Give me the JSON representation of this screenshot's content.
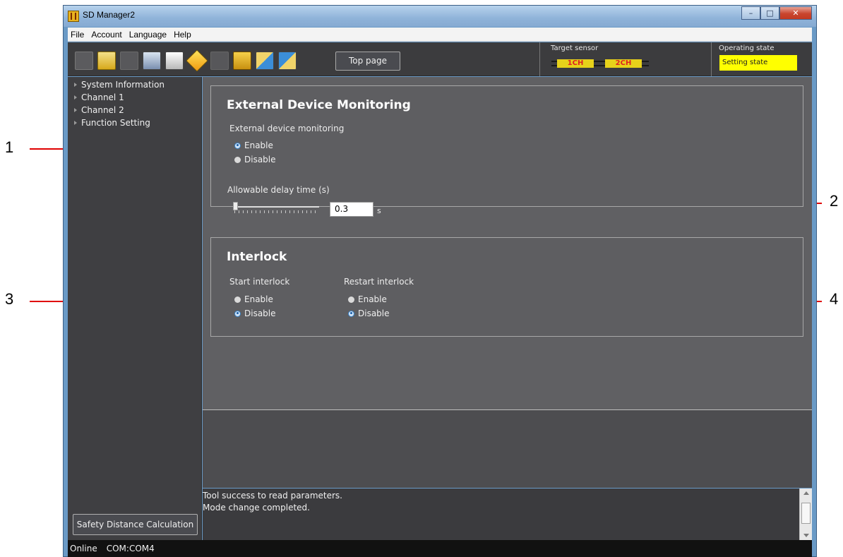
{
  "window": {
    "title": "SD Manager2"
  },
  "menu": [
    "File",
    "Account",
    "Language",
    "Help"
  ],
  "toolbar": {
    "top_page_label": "Top page",
    "icons": [
      "device-icon",
      "folder-open-icon",
      "disabled-device-icon",
      "save-icon",
      "print-icon",
      "transfer-icon",
      "key-icon",
      "lock-icon",
      "import-icon",
      "export-icon"
    ]
  },
  "target_sensor": {
    "label": "Target sensor",
    "ch1": "1CH",
    "ch2": "2CH"
  },
  "operating_state": {
    "label": "Operating state",
    "value": "Setting state"
  },
  "tree": [
    "System Information",
    "Channel 1",
    "Channel 2",
    "Function Setting"
  ],
  "left_button": "Safety Distance Calculation",
  "edm": {
    "title": "External Device Monitoring",
    "monitoring_label": "External device monitoring",
    "enable": "Enable",
    "disable": "Disable",
    "selected": "Enable",
    "delay_label": "Allowable delay time (s)",
    "delay_value": "0.3",
    "delay_unit": "s",
    "slider_position": 0
  },
  "interlock": {
    "title": "Interlock",
    "start_label": "Start interlock",
    "restart_label": "Restart interlock",
    "enable": "Enable",
    "disable": "Disable",
    "start_selected": "Disable",
    "restart_selected": "Disable"
  },
  "log": [
    "Tool success to read parameters.",
    "Mode change completed."
  ],
  "status": {
    "connection": "Online",
    "port": "COM:COM4"
  },
  "callouts": [
    "1",
    "2",
    "3",
    "4"
  ],
  "colors": {
    "op_state_bg": "#ffff00",
    "callout": "#e00000",
    "sensor_ch": "#e7d11a"
  }
}
